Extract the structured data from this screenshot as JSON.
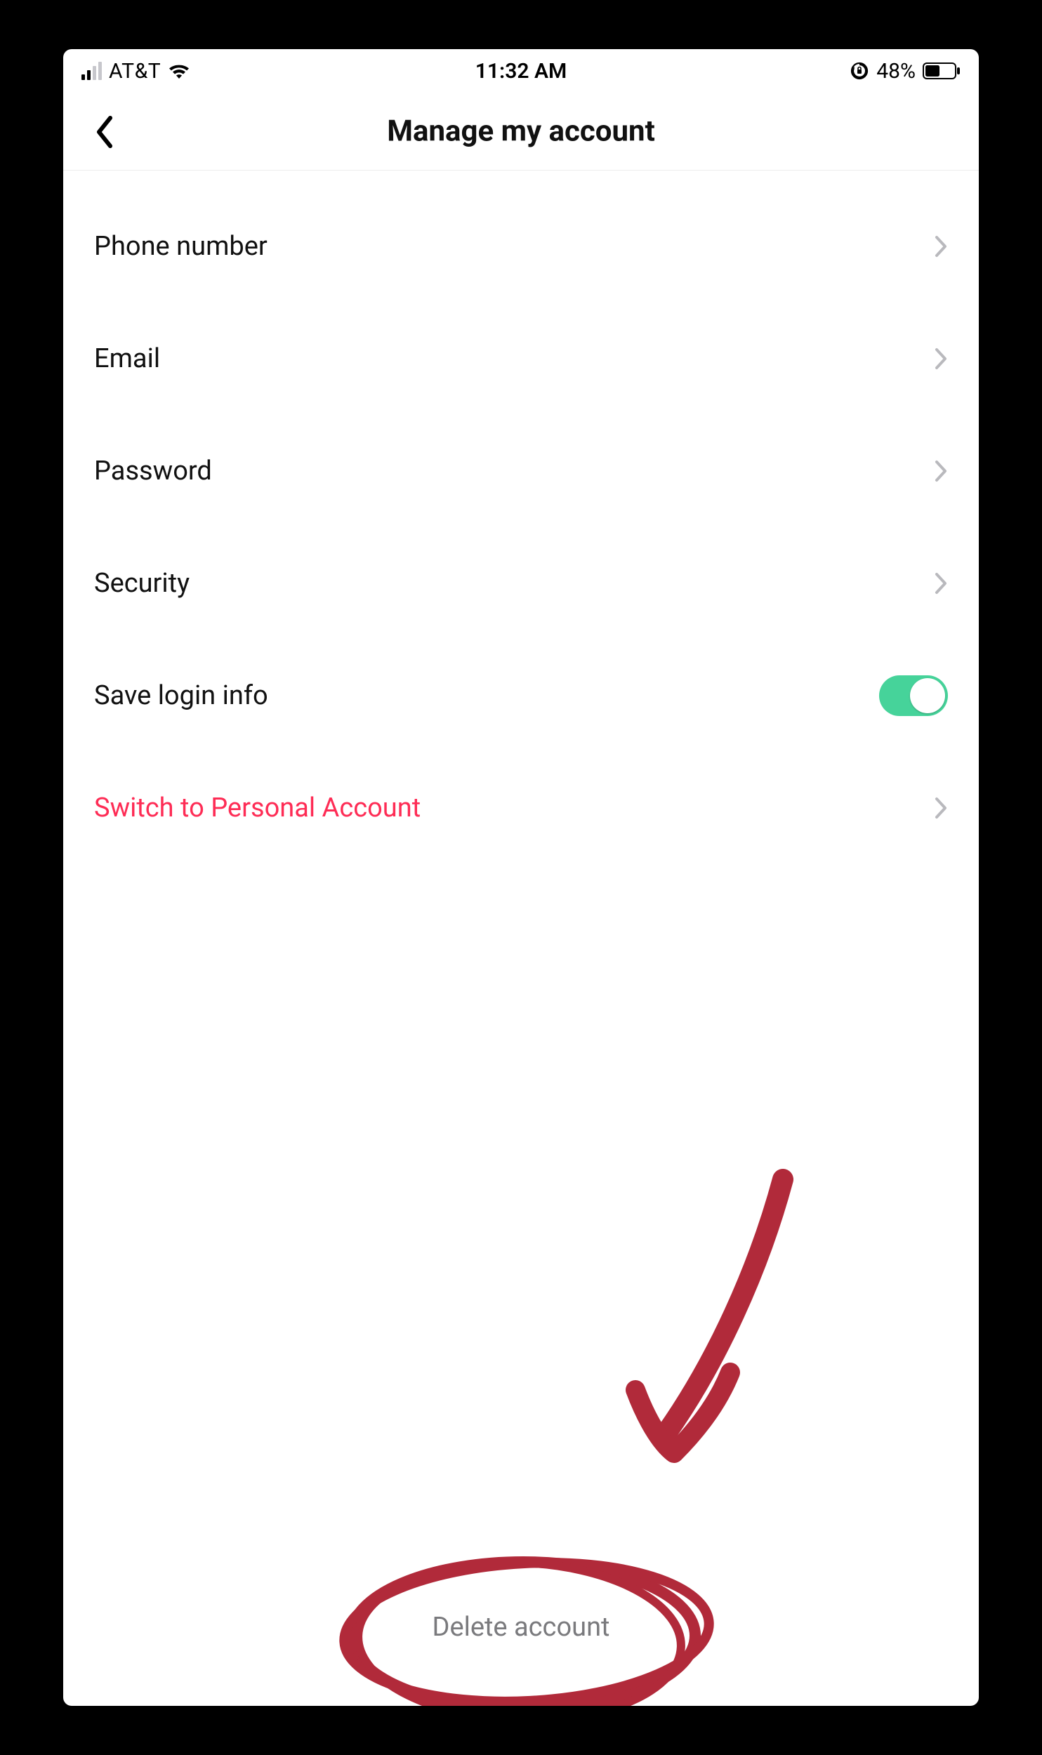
{
  "status": {
    "carrier": "AT&T",
    "time": "11:32 AM",
    "battery_pct": "48%",
    "signal_active_bars": 2
  },
  "header": {
    "title": "Manage my account"
  },
  "rows": {
    "phone": {
      "label": "Phone number"
    },
    "email": {
      "label": "Email"
    },
    "password": {
      "label": "Password"
    },
    "security": {
      "label": "Security"
    },
    "save_login": {
      "label": "Save login info",
      "toggle_on": true
    },
    "switch_personal": {
      "label": "Switch to Personal Account"
    }
  },
  "footer": {
    "delete_account": "Delete account"
  },
  "annotation": {
    "color": "#b12a3a"
  }
}
